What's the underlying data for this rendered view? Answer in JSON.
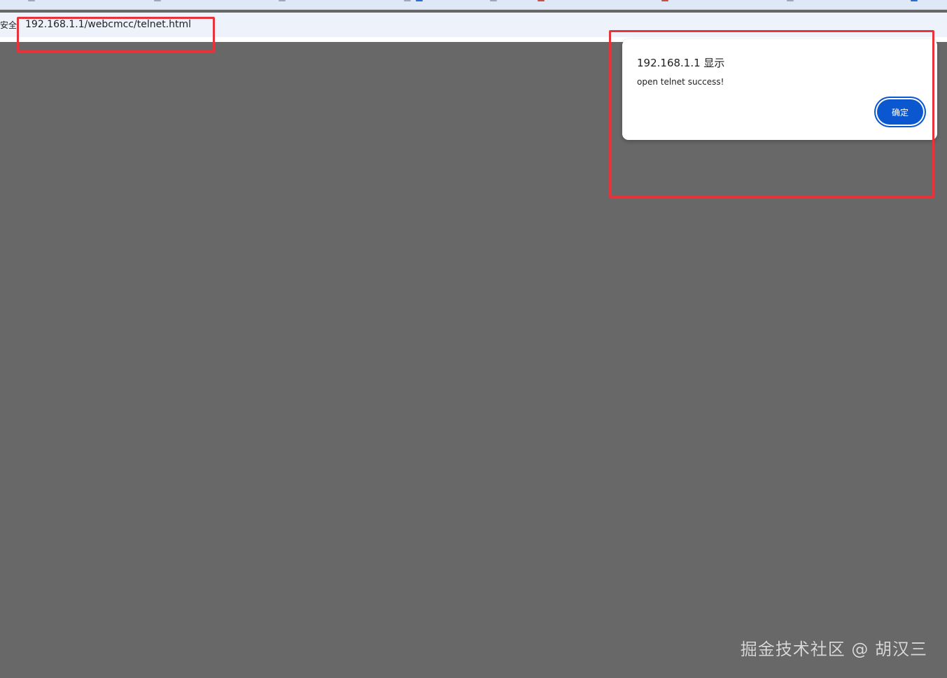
{
  "browser": {
    "security_label": "安全",
    "url": "192.168.1.1/webcmcc/telnet.html"
  },
  "alert": {
    "title": "192.168.1.1 显示",
    "message": "open telnet success!",
    "ok_label": "确定"
  },
  "watermark": {
    "text": "掘金技术社区 @ 胡汉三"
  },
  "colors": {
    "overlay": "#686868",
    "button": "#0b57d0",
    "annotation": "#e8333a",
    "address_bar": "#eef2fb"
  }
}
